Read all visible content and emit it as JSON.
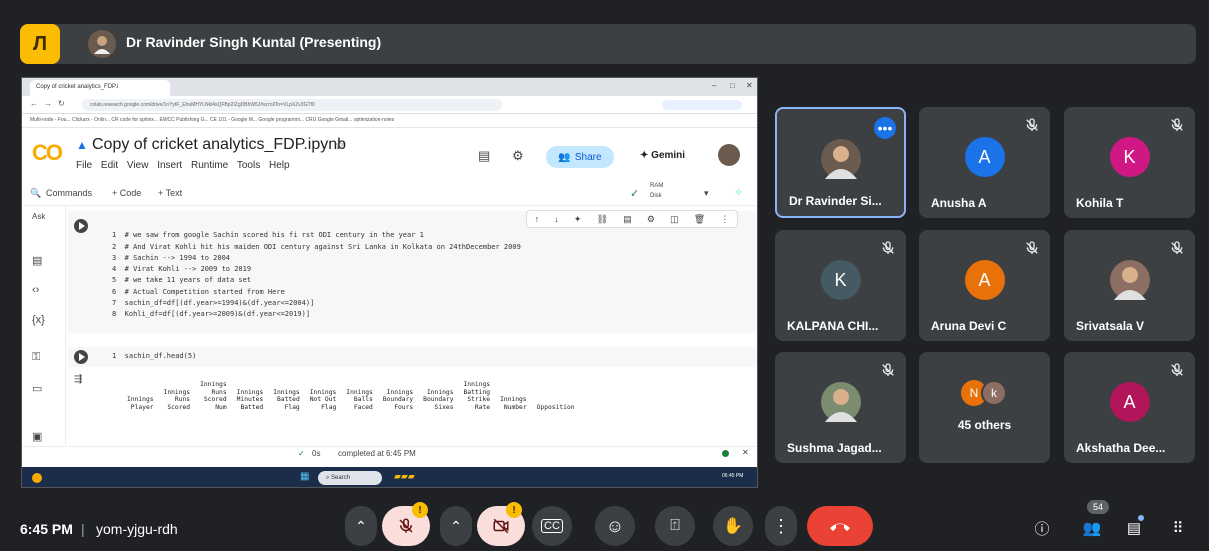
{
  "meet": {
    "logo_letter": "Л",
    "presenter_banner": "Dr Ravinder Singh Kuntal (Presenting)",
    "time": "6:45 PM",
    "meeting_code": "yom-yjgu-rdh",
    "people_count": "54"
  },
  "shared_screen": {
    "browser_tab": "Copy of cricket analytics_FDP.i",
    "url": "colab.research.google.com/drive/1nYytF_EhuMHYLNkl4sQFBp2IZgDBhW5J#scrollTo=VLpXZv3GTf0",
    "bookmarks": "Multi-node - Fou...   Clickarx - Onlin...   CR code for sphinx...   EWCC Publishing G...   CE 101 - Google M...   Google programmi...   CRU Google Gmail...   optimization-notes",
    "notebook_title": "Copy of cricket analytics_FDP.ipynb",
    "menus": [
      "File",
      "Edit",
      "View",
      "Insert",
      "Runtime",
      "Tools",
      "Help"
    ],
    "share_label": "Share",
    "gemini_label": "Gemini",
    "commands_label": "Commands",
    "add_code_label": "+ Code",
    "add_text_label": "+ Text",
    "ram_label": "RAM",
    "disk_label": "Disk",
    "code_cell_lines": [
      "1  # we saw from google Sachin scored his fi rst ODI century in the year 1",
      "2  # And Virat Kohli hit his maiden ODI century against Sri Lanka in Kolkata on 24thDecember 2009",
      "3  # Sachin --> 1994 to 2004",
      "4  # Virat Kohli --> 2009 to 2019",
      "5  # we take 11 years of data set",
      "6  # Actual Competition started from Here",
      "7  sachin_df=df[(df.year>=1994)&(df.year<=2004)]",
      "8  Kohli_df=df[(df.year>=2009)&(df.year<=2019)]"
    ],
    "head_cell": "1  sachin_df.head(5)",
    "df_columns": [
      [
        "Innings",
        "Player"
      ],
      [
        "Innings",
        "Runs",
        "Scored"
      ],
      [
        "Innings",
        "Runs",
        "Scored",
        "Num"
      ],
      [
        "Innings",
        "Minutes",
        "Batted"
      ],
      [
        "Innings",
        "Batted",
        "Flag"
      ],
      [
        "Innings",
        "Not Out",
        "Flag"
      ],
      [
        "Innings",
        "Balls",
        "Faced"
      ],
      [
        "Innings",
        "Boundary",
        "Fours"
      ],
      [
        "Innings",
        "Boundary",
        "Sixes"
      ],
      [
        "Innings",
        "Batting",
        "Strike",
        "Rate"
      ],
      [
        "Innings",
        "Number"
      ],
      [
        "Opposition"
      ]
    ],
    "status_time": "0s",
    "status_text": "completed at 6:45 PM",
    "taskbar_search": "Search",
    "taskbar_clock": "06:45 PM"
  },
  "participants": [
    {
      "name": "Dr Ravinder Si...",
      "initial": "",
      "color": "#6b5a4e",
      "photo": true,
      "active": true
    },
    {
      "name": "Anusha A",
      "initial": "A",
      "color": "#1a73e8"
    },
    {
      "name": "Kohila T",
      "initial": "K",
      "color": "#d01884"
    },
    {
      "name": "KALPANA CHI...",
      "initial": "K",
      "color": "#455a64"
    },
    {
      "name": "Aruna Devi C",
      "initial": "A",
      "color": "#e8710a"
    },
    {
      "name": "Srivatsala V",
      "initial": "",
      "color": "#8d6e63",
      "photo": true
    },
    {
      "name": "Sushma Jagad...",
      "initial": "",
      "color": "#7c8c6e",
      "photo": true
    },
    {
      "name": "45 others",
      "initial": "",
      "color": "",
      "others": true
    },
    {
      "name": "Akshatha Dee...",
      "initial": "A",
      "color": "#b3155a"
    }
  ],
  "others_initials": [
    "N",
    "k"
  ],
  "colors": {
    "accent_blue": "#8ab4f8",
    "end_call_red": "#ea4335",
    "warning_yellow": "#fbbc04"
  }
}
